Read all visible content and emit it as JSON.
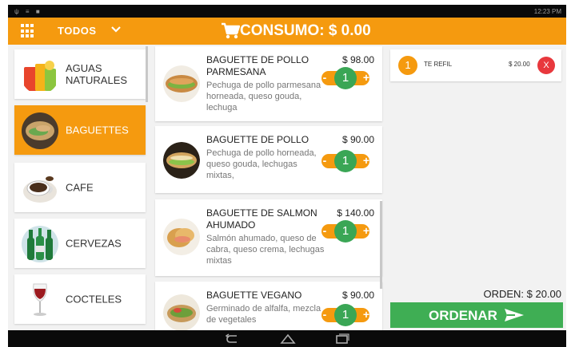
{
  "status_bar": {
    "left_icons": "ψ ≡ ■",
    "right_text": "12:23 PM"
  },
  "header": {
    "menu_icon": "grid-icon",
    "category_filter": "TODOS",
    "dropdown_icon": "chevron-down-icon",
    "cart_icon": "cart-icon",
    "consumo_label": "CONSUMO: $ 0.00"
  },
  "categories": [
    {
      "label": "AGUAS NATURALES",
      "icon": "juice-glasses",
      "active": false
    },
    {
      "label": "BAGUETTES",
      "icon": "baguette-plate",
      "active": true
    },
    {
      "label": "CAFE",
      "icon": "coffee-cup",
      "active": false
    },
    {
      "label": "CERVEZAS",
      "icon": "beer-bottles",
      "active": false
    },
    {
      "label": "COCTELES",
      "icon": "wine-glass",
      "active": false
    }
  ],
  "products": [
    {
      "name": "BAGUETTE DE POLLO PARMESANA",
      "price": "$ 98.00",
      "description": "Pechuga de pollo parmesana horneada, queso gouda, lechuga",
      "qty": "1",
      "minus": "-",
      "plus": "+"
    },
    {
      "name": "BAGUETTE DE POLLO",
      "price": "$ 90.00",
      "description": "Pechuga de pollo horneada, queso gouda, lechugas mixtas,",
      "qty": "1",
      "minus": "-",
      "plus": "+"
    },
    {
      "name": "BAGUETTE DE SALMON AHUMADO",
      "price": "$ 140.00",
      "description": "Salmón ahumado, queso de cabra, queso crema, lechugas mixtas",
      "qty": "1",
      "minus": "-",
      "plus": "+"
    },
    {
      "name": "BAGUETTE VEGANO",
      "price": "$ 90.00",
      "description": "Germinado de alfalfa, mezcla de vegetales",
      "qty": "1",
      "minus": "-",
      "plus": "+"
    }
  ],
  "order": {
    "items": [
      {
        "qty": "1",
        "name": "TE REFIL",
        "price": "$ 20.00",
        "remove": "X"
      }
    ],
    "total": "ORDEN: $ 20.00",
    "submit_label": "ORDENAR",
    "submit_icon": "send-icon"
  },
  "colors": {
    "accent": "#f59a0f",
    "green": "#3aa655",
    "remove": "#e8383d"
  }
}
